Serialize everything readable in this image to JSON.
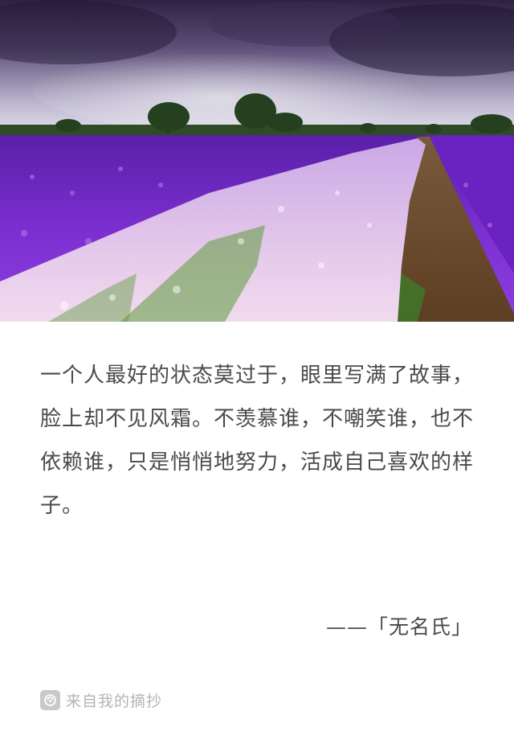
{
  "hero": {
    "image_alt": "lavender field under a stormy purple sky",
    "colors": {
      "sky_dark": "#3a2a52",
      "sky_light": "#d8d4e6",
      "lavender": "#7a2fc9",
      "lavender_light": "#d9b8e6",
      "path": "#6b4a2b"
    }
  },
  "quote": {
    "text": "一个人最好的状态莫过于，眼里写满了故事，脸上却不见风霜。不羡慕谁，不嘲笑谁，也不依赖谁，只是悄悄地努力，活成自己喜欢的样子。"
  },
  "author": {
    "text": "——「无名氏」"
  },
  "footer": {
    "icon": "app-logo-icon",
    "text": "来自我的摘抄"
  }
}
